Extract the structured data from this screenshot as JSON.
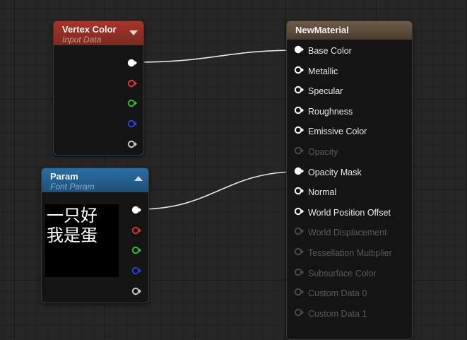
{
  "nodes": {
    "vertex_color": {
      "title": "Vertex Color",
      "subtitle": "Input Data",
      "outputs": [
        "white",
        "red",
        "green",
        "blue",
        "gray"
      ]
    },
    "param": {
      "title": "Param",
      "subtitle": "Font Param",
      "preview_lines": [
        "一只好",
        "我是蛋"
      ],
      "outputs": [
        "white",
        "red",
        "green",
        "blue",
        "gray"
      ]
    },
    "material": {
      "title": "NewMaterial",
      "inputs": [
        {
          "label": "Base Color",
          "enabled": true,
          "connected": true
        },
        {
          "label": "Metallic",
          "enabled": true,
          "connected": false
        },
        {
          "label": "Specular",
          "enabled": true,
          "connected": false
        },
        {
          "label": "Roughness",
          "enabled": true,
          "connected": false
        },
        {
          "label": "Emissive Color",
          "enabled": true,
          "connected": false
        },
        {
          "label": "Opacity",
          "enabled": false,
          "connected": false
        },
        {
          "label": "Opacity Mask",
          "enabled": true,
          "connected": true
        },
        {
          "label": "Normal",
          "enabled": true,
          "connected": false
        },
        {
          "label": "World Position Offset",
          "enabled": true,
          "connected": false
        },
        {
          "label": "World Displacement",
          "enabled": false,
          "connected": false
        },
        {
          "label": "Tessellation Multiplier",
          "enabled": false,
          "connected": false
        },
        {
          "label": "Subsurface Color",
          "enabled": false,
          "connected": false
        },
        {
          "label": "Custom Data 0",
          "enabled": false,
          "connected": false
        },
        {
          "label": "Custom Data 1",
          "enabled": false,
          "connected": false
        }
      ]
    }
  },
  "colors": {
    "white": "#ffffff",
    "red": "#e0302a",
    "green": "#2fbf2f",
    "blue": "#2a3fd8",
    "gray": "#c8c8c8",
    "disabled": "#4a4a4a",
    "wire": "#e6e6e6"
  }
}
